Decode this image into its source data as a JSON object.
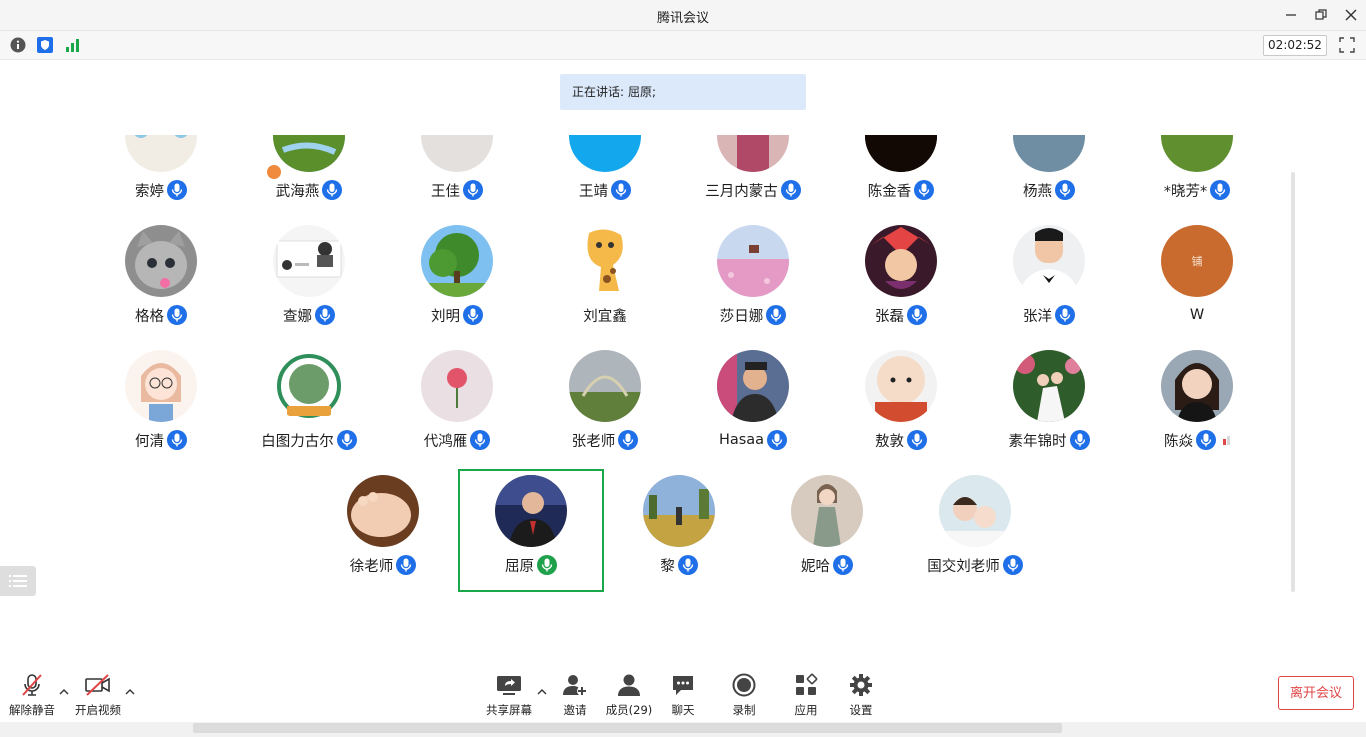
{
  "window": {
    "title": "腾讯会议"
  },
  "infobar": {
    "timer": "02:02:52"
  },
  "speaking": {
    "label": "正在讲话:",
    "names": "屈原;"
  },
  "participants": [
    {
      "name": "索婷",
      "mic": "on",
      "avatar": "avatar-cartoon-tiger"
    },
    {
      "name": "武海燕",
      "mic": "on",
      "avatar": "avatar-landscape",
      "host": true
    },
    {
      "name": "王佳",
      "mic": "on",
      "avatar": "avatar-portrait"
    },
    {
      "name": "王靖",
      "mic": "on",
      "avatar": "avatar-blue-sky"
    },
    {
      "name": "三月内蒙古",
      "mic": "on",
      "avatar": "avatar-pink-portrait"
    },
    {
      "name": "陈金香",
      "mic": "on",
      "avatar": "avatar-sunset"
    },
    {
      "name": "杨燕",
      "mic": "on",
      "avatar": "avatar-lake"
    },
    {
      "name": "*晓芳*",
      "mic": "on",
      "avatar": "avatar-sunflower"
    },
    {
      "name": "格格",
      "mic": "on",
      "avatar": "avatar-kitten"
    },
    {
      "name": "查娜",
      "mic": "on",
      "avatar": "avatar-screenshot"
    },
    {
      "name": "刘明",
      "mic": "on",
      "avatar": "avatar-tree"
    },
    {
      "name": "刘宜鑫",
      "mic": "none",
      "avatar": "avatar-giraffe"
    },
    {
      "name": "莎日娜",
      "mic": "on",
      "avatar": "avatar-flower-field"
    },
    {
      "name": "张磊",
      "mic": "on",
      "avatar": "avatar-game-hero"
    },
    {
      "name": "张洋",
      "mic": "on",
      "avatar": "avatar-man-suit"
    },
    {
      "name": "W",
      "mic": "none",
      "avatar": "avatar-orange-card"
    },
    {
      "name": "何清",
      "mic": "on",
      "avatar": "avatar-girl-drawing"
    },
    {
      "name": "白图力古尔",
      "mic": "on",
      "avatar": "avatar-badge"
    },
    {
      "name": "代鸿雁",
      "mic": "on",
      "avatar": "avatar-rose"
    },
    {
      "name": "张老师",
      "mic": "on",
      "avatar": "avatar-rainbow"
    },
    {
      "name": "Hasaa",
      "mic": "on",
      "avatar": "avatar-man-city"
    },
    {
      "name": "敖敦",
      "mic": "on",
      "avatar": "avatar-doll"
    },
    {
      "name": "素年锦时",
      "mic": "on",
      "avatar": "avatar-couple"
    },
    {
      "name": "陈焱",
      "mic": "on",
      "avatar": "avatar-woman-smile",
      "signal": true
    },
    {
      "name": "徐老师",
      "mic": "on",
      "avatar": "avatar-baby-feet"
    },
    {
      "name": "屈原",
      "mic": "speaking",
      "avatar": "avatar-man-tv",
      "active": true
    },
    {
      "name": "黎",
      "mic": "on",
      "avatar": "avatar-field-person"
    },
    {
      "name": "妮哈",
      "mic": "on",
      "avatar": "avatar-fashion-sketch"
    },
    {
      "name": "国交刘老师",
      "mic": "on",
      "avatar": "avatar-mother-child"
    }
  ],
  "toolbar": {
    "unmute": "解除静音",
    "start_video": "开启视频",
    "share_screen": "共享屏幕",
    "invite": "邀请",
    "members": "成员(29)",
    "chat": "聊天",
    "record": "录制",
    "apps": "应用",
    "settings": "设置",
    "leave": "离开会议"
  },
  "colors": {
    "accent": "#1e6fe8",
    "active": "#1aa74a",
    "leave": "#e04545",
    "banner": "#dbe9fb"
  }
}
